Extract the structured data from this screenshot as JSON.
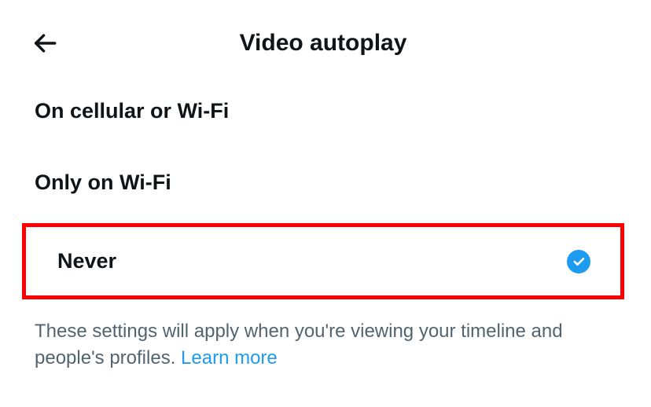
{
  "header": {
    "title": "Video autoplay"
  },
  "options": [
    {
      "label": "On cellular or Wi-Fi",
      "selected": false,
      "highlighted": false
    },
    {
      "label": "Only on Wi-Fi",
      "selected": false,
      "highlighted": false
    },
    {
      "label": "Never",
      "selected": true,
      "highlighted": true
    }
  ],
  "description": {
    "text": "These settings will apply when you're viewing your timeline and people's profiles. ",
    "link_label": "Learn more"
  }
}
